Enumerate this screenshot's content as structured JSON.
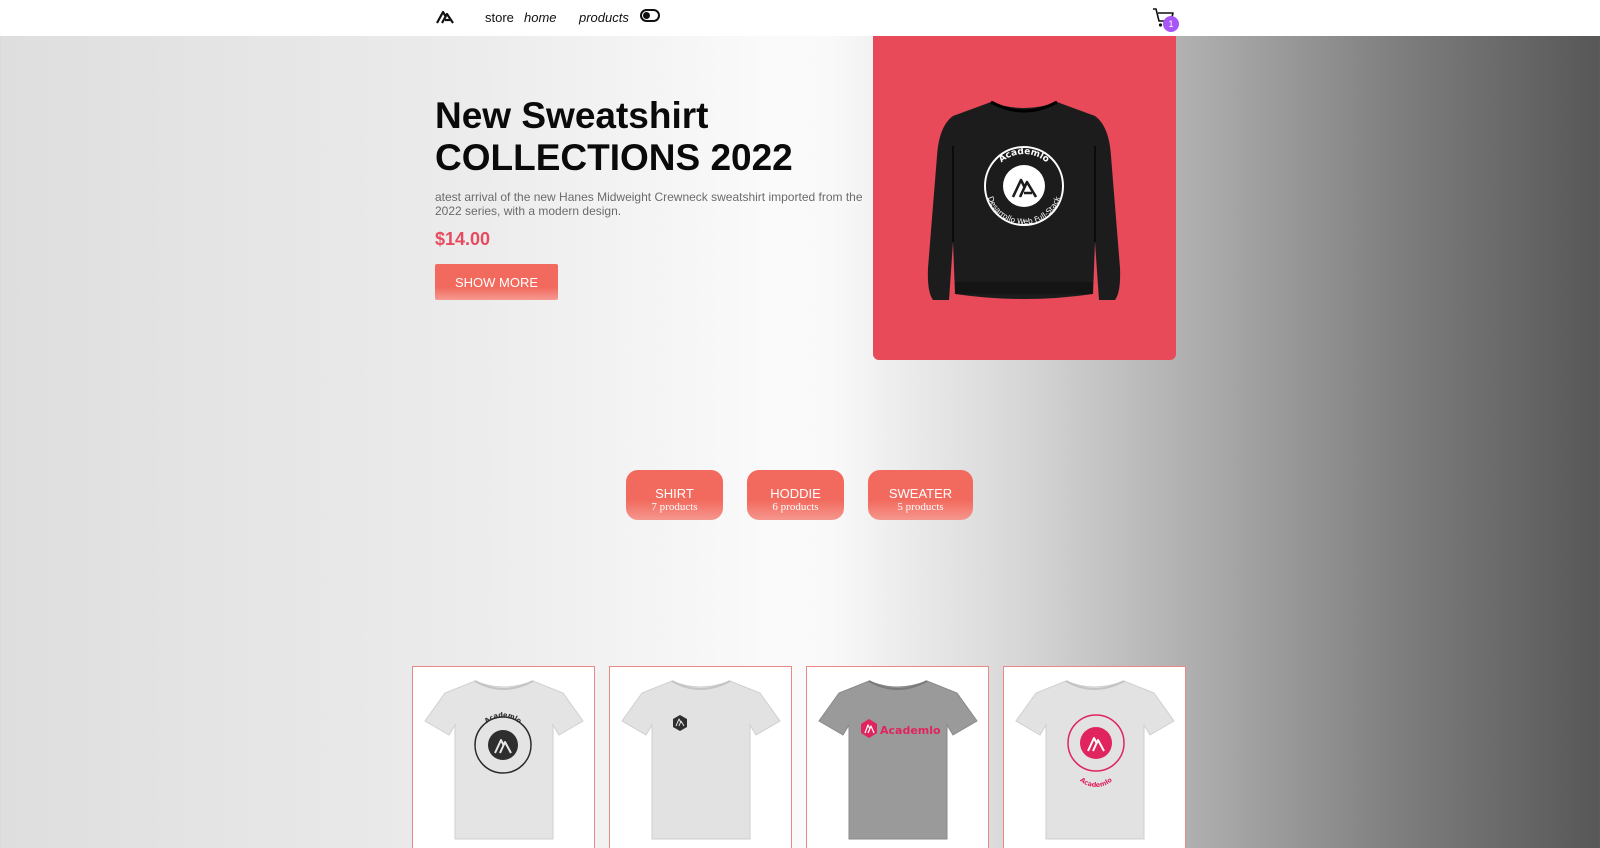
{
  "header": {
    "logo_icon": "academlo-logo-icon",
    "nav": {
      "store": "store",
      "home": "home",
      "products": "products"
    },
    "theme_toggle_icon": "toggle-icon",
    "cart_icon": "cart-icon",
    "cart_count": "1"
  },
  "hero": {
    "title": "New Sweatshirt\nCOLLECTIONS 2022",
    "description": "atest arrival of the new Hanes Midweight Crewneck sweatshirt imported from the 2022 series, with a modern design.",
    "price": "$14.00",
    "button_label": "SHOW MORE",
    "image_icon": "sweatshirt-image",
    "image_print": {
      "top": "Academlo",
      "bottom": "Desarrollo Web Full-Stack"
    }
  },
  "categories": [
    {
      "name": "SHIRT",
      "count": "7 products"
    },
    {
      "name": "HODDIE",
      "count": "6 products"
    },
    {
      "name": "SWEATER",
      "count": "5 products"
    }
  ],
  "products": [
    {
      "image_icon": "tshirt-circle-logo-image",
      "shirt_color": "#e4e4e4",
      "print": "Academlo"
    },
    {
      "image_icon": "tshirt-small-logo-image",
      "shirt_color": "#e2e2e2"
    },
    {
      "image_icon": "tshirt-wordmark-image",
      "shirt_color": "#9a9a9a",
      "print": "Academlo"
    },
    {
      "image_icon": "tshirt-pink-circle-image",
      "shirt_color": "#e2e2e2",
      "print": "Academlo"
    }
  ],
  "colors": {
    "accent": "#f26a5e",
    "price": "#e64b5e",
    "hero_image_bg": "#e84a5a",
    "cart_badge": "#a855f7",
    "card_border": "#e88a84"
  }
}
